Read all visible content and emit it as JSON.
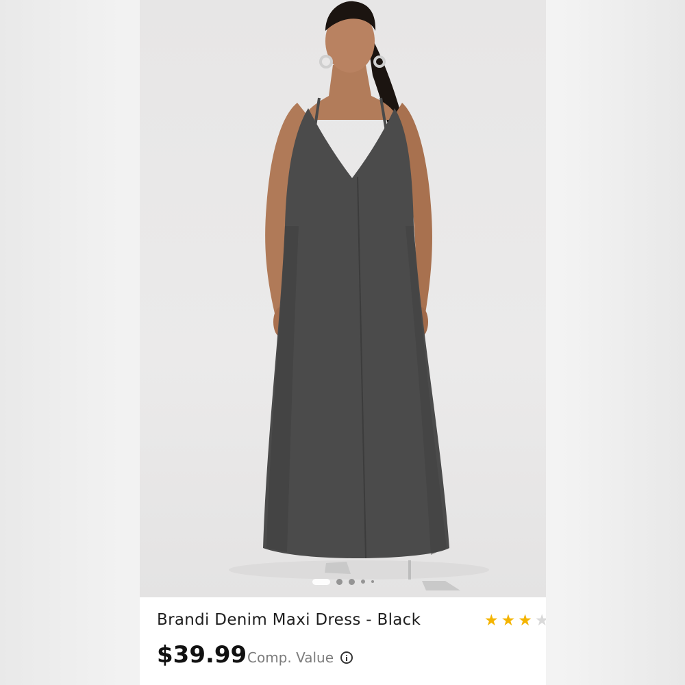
{
  "product": {
    "title": "Brandi Denim Maxi Dress - Black",
    "price": "$39.99",
    "comp_value_label": "Comp. Value",
    "rating": 3,
    "rating_max": 5,
    "image_alt_icon": "product-photo",
    "carousel": {
      "total": 5,
      "active": 0
    }
  },
  "colors": {
    "star": "#f4b400",
    "dress": "#4b4b4b",
    "background": "#ebeaea"
  },
  "icons": {
    "info": "info-circle-icon",
    "star": "star-icon"
  }
}
